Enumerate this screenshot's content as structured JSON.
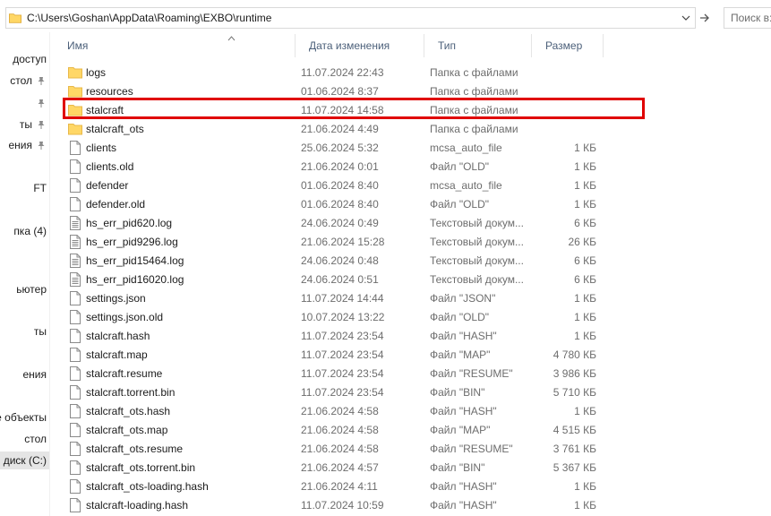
{
  "address_bar": {
    "path": "C:\\Users\\Goshan\\AppData\\Roaming\\EXBO\\runtime",
    "search_placeholder": "Поиск в: runtime"
  },
  "nav": {
    "items": [
      {
        "label": "доступ",
        "pinned": false
      },
      {
        "label": "стол",
        "pinned": true
      },
      {
        "label": "",
        "pinned": true
      },
      {
        "label": "ты",
        "pinned": true
      },
      {
        "label": "ения",
        "pinned": true
      },
      {
        "label": "FT",
        "pinned": false
      },
      {
        "label": "пка (4)",
        "pinned": false
      },
      {
        "label": "ьютер",
        "pinned": false
      },
      {
        "label": "ты",
        "pinned": false
      },
      {
        "label": "ения",
        "pinned": false
      },
      {
        "label": "ые объекты",
        "pinned": false
      },
      {
        "label": "стол",
        "pinned": false
      },
      {
        "label": "ый диск (C:)",
        "pinned": false
      }
    ]
  },
  "columns": {
    "name": "Имя",
    "date": "Дата изменения",
    "type": "Тип",
    "size": "Размер"
  },
  "files": [
    {
      "name": "logs",
      "date": "11.07.2024 22:43",
      "type": "Папка с файлами",
      "size": "",
      "kind": "folder"
    },
    {
      "name": "resources",
      "date": "01.06.2024 8:37",
      "type": "Папка с файлами",
      "size": "",
      "kind": "folder"
    },
    {
      "name": "stalcraft",
      "date": "11.07.2024 14:58",
      "type": "Папка с файлами",
      "size": "",
      "kind": "folder"
    },
    {
      "name": "stalcraft_ots",
      "date": "21.06.2024 4:49",
      "type": "Папка с файлами",
      "size": "",
      "kind": "folder"
    },
    {
      "name": "clients",
      "date": "25.06.2024 5:32",
      "type": "mcsa_auto_file",
      "size": "1 КБ",
      "kind": "file"
    },
    {
      "name": "clients.old",
      "date": "21.06.2024 0:01",
      "type": "Файл \"OLD\"",
      "size": "1 КБ",
      "kind": "file"
    },
    {
      "name": "defender",
      "date": "01.06.2024 8:40",
      "type": "mcsa_auto_file",
      "size": "1 КБ",
      "kind": "file"
    },
    {
      "name": "defender.old",
      "date": "01.06.2024 8:40",
      "type": "Файл \"OLD\"",
      "size": "1 КБ",
      "kind": "file"
    },
    {
      "name": "hs_err_pid620.log",
      "date": "24.06.2024 0:49",
      "type": "Текстовый докум...",
      "size": "6 КБ",
      "kind": "text"
    },
    {
      "name": "hs_err_pid9296.log",
      "date": "21.06.2024 15:28",
      "type": "Текстовый докум...",
      "size": "26 КБ",
      "kind": "text"
    },
    {
      "name": "hs_err_pid15464.log",
      "date": "24.06.2024 0:48",
      "type": "Текстовый докум...",
      "size": "6 КБ",
      "kind": "text"
    },
    {
      "name": "hs_err_pid16020.log",
      "date": "24.06.2024 0:51",
      "type": "Текстовый докум...",
      "size": "6 КБ",
      "kind": "text"
    },
    {
      "name": "settings.json",
      "date": "11.07.2024 14:44",
      "type": "Файл \"JSON\"",
      "size": "1 КБ",
      "kind": "file"
    },
    {
      "name": "settings.json.old",
      "date": "10.07.2024 13:22",
      "type": "Файл \"OLD\"",
      "size": "1 КБ",
      "kind": "file"
    },
    {
      "name": "stalcraft.hash",
      "date": "11.07.2024 23:54",
      "type": "Файл \"HASH\"",
      "size": "1 КБ",
      "kind": "file"
    },
    {
      "name": "stalcraft.map",
      "date": "11.07.2024 23:54",
      "type": "Файл \"MAP\"",
      "size": "4 780 КБ",
      "kind": "file"
    },
    {
      "name": "stalcraft.resume",
      "date": "11.07.2024 23:54",
      "type": "Файл \"RESUME\"",
      "size": "3 986 КБ",
      "kind": "file"
    },
    {
      "name": "stalcraft.torrent.bin",
      "date": "11.07.2024 23:54",
      "type": "Файл \"BIN\"",
      "size": "5 710 КБ",
      "kind": "file"
    },
    {
      "name": "stalcraft_ots.hash",
      "date": "21.06.2024 4:58",
      "type": "Файл \"HASH\"",
      "size": "1 КБ",
      "kind": "file"
    },
    {
      "name": "stalcraft_ots.map",
      "date": "21.06.2024 4:58",
      "type": "Файл \"MAP\"",
      "size": "4 515 КБ",
      "kind": "file"
    },
    {
      "name": "stalcraft_ots.resume",
      "date": "21.06.2024 4:58",
      "type": "Файл \"RESUME\"",
      "size": "3 761 КБ",
      "kind": "file"
    },
    {
      "name": "stalcraft_ots.torrent.bin",
      "date": "21.06.2024 4:57",
      "type": "Файл \"BIN\"",
      "size": "5 367 КБ",
      "kind": "file"
    },
    {
      "name": "stalcraft_ots-loading.hash",
      "date": "21.06.2024 4:11",
      "type": "Файл \"HASH\"",
      "size": "1 КБ",
      "kind": "file"
    },
    {
      "name": "stalcraft-loading.hash",
      "date": "11.07.2024 10:59",
      "type": "Файл \"HASH\"",
      "size": "1 КБ",
      "kind": "file"
    }
  ],
  "highlighted_item": "stalcraft",
  "colors": {
    "folder": "#ffd766",
    "folder_dark": "#e8b84a",
    "highlight": "#e00000",
    "header_text": "#4c607a"
  }
}
